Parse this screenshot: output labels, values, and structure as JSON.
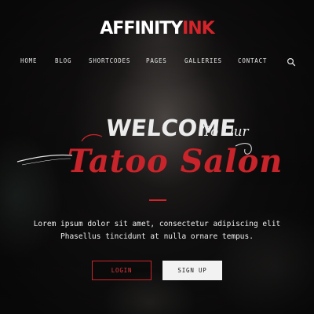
{
  "header": {
    "logo_part1": "AFFINITY",
    "logo_part2": "INK"
  },
  "nav": {
    "items": [
      "HOME",
      "BLOG",
      "SHORTCODES",
      "PAGES",
      "GALLERIES",
      "CONTACT"
    ],
    "search_icon": "search-icon"
  },
  "hero": {
    "welcome": "WELCOME",
    "to_our": "To Our",
    "title": "Tatoo Salon",
    "description_line1": "Lorem ipsum dolor sit amet, consectetur adipiscing elit",
    "description_line2": "Phasellus tincidunt at nulla ornare tempus."
  },
  "buttons": {
    "login": "LOGIN",
    "signup": "SIGN UP"
  },
  "colors": {
    "accent": "#d4242a",
    "text": "#f0f0f0",
    "background": "#0c0b0b"
  }
}
